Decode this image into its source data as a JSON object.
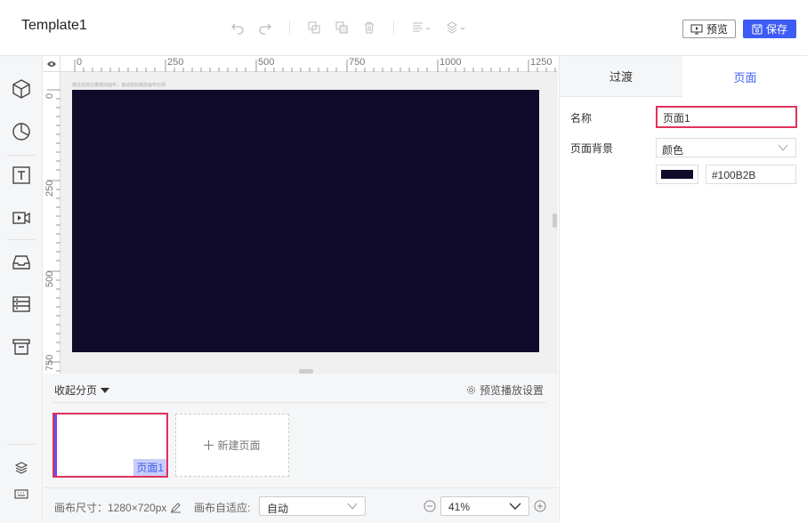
{
  "app": {
    "title": "Template1"
  },
  "toolbar": {
    "preview_label": "预览",
    "save_label": "保存",
    "icons": [
      "undo-icon",
      "redo-icon",
      "copy-icon",
      "duplicate-icon",
      "delete-icon",
      "align-icon",
      "layer-order-icon"
    ]
  },
  "sidebar": {
    "icons": [
      "cube-icon",
      "pie-chart-icon",
      "text-icon",
      "video-icon",
      "inbox-icon",
      "list-icon",
      "archive-icon",
      "layers-icon",
      "keyboard-icon"
    ]
  },
  "ruler": {
    "top_labels": [
      "0",
      "250",
      "500",
      "750",
      "1000",
      "1250"
    ],
    "left_labels": [
      "0",
      "250",
      "500",
      "750"
    ]
  },
  "canvas": {
    "hint": "按住鼠标左键拖动画布，滚动鼠标缩放画布比例",
    "background": "#100B2B"
  },
  "pages": {
    "collapse_label": "收起分页",
    "play_settings": "预览播放设置",
    "items": [
      {
        "label": "页面1"
      }
    ],
    "new_page_label": "新建页面"
  },
  "footer": {
    "canvas_size": "画布尺寸：1280×720px",
    "adapt_label": "画布自适应:",
    "adapt_value": "自动",
    "zoom_value": "41%"
  },
  "panel": {
    "tabs": [
      "过渡",
      "页面"
    ],
    "name_label": "名称",
    "name_value": "页面1",
    "bg_label": "页面背景",
    "bg_type": "颜色",
    "bg_hex": "#100B2B"
  },
  "colors": {
    "accent": "#3d5cf5",
    "selected_border": "#e0325a"
  }
}
